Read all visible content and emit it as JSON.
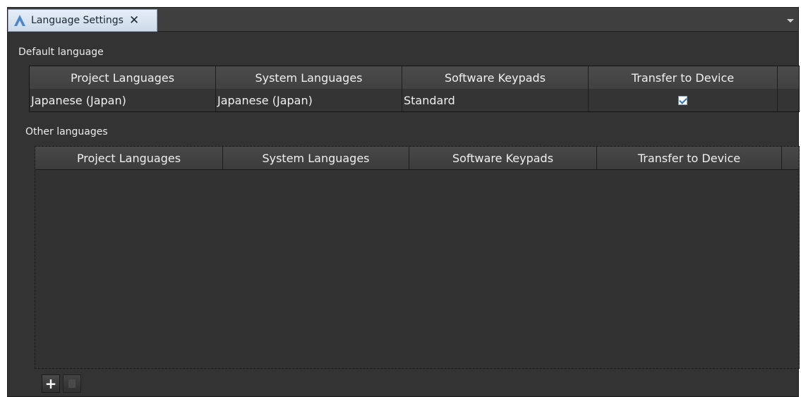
{
  "tab": {
    "title": "Language Settings",
    "close_glyph": "✕"
  },
  "default_section": {
    "title": "Default language",
    "columns": [
      "Project Languages",
      "System Languages",
      "Software Keypads",
      "Transfer to Device"
    ],
    "row": {
      "project_language": "Japanese (Japan)",
      "system_language": "Japanese (Japan)",
      "software_keypad": "Standard",
      "transfer_to_device": true
    }
  },
  "other_section": {
    "title": "Other languages",
    "columns": [
      "Project Languages",
      "System Languages",
      "Software Keypads",
      "Transfer to Device"
    ],
    "rows": []
  },
  "toolbar": {
    "add_label": "+",
    "add_icon": "plus-icon",
    "delete_icon": "trash-icon"
  },
  "colors": {
    "panel": "#333333",
    "tab_active": "#dbe5f0",
    "check": "#2d6fc4"
  }
}
